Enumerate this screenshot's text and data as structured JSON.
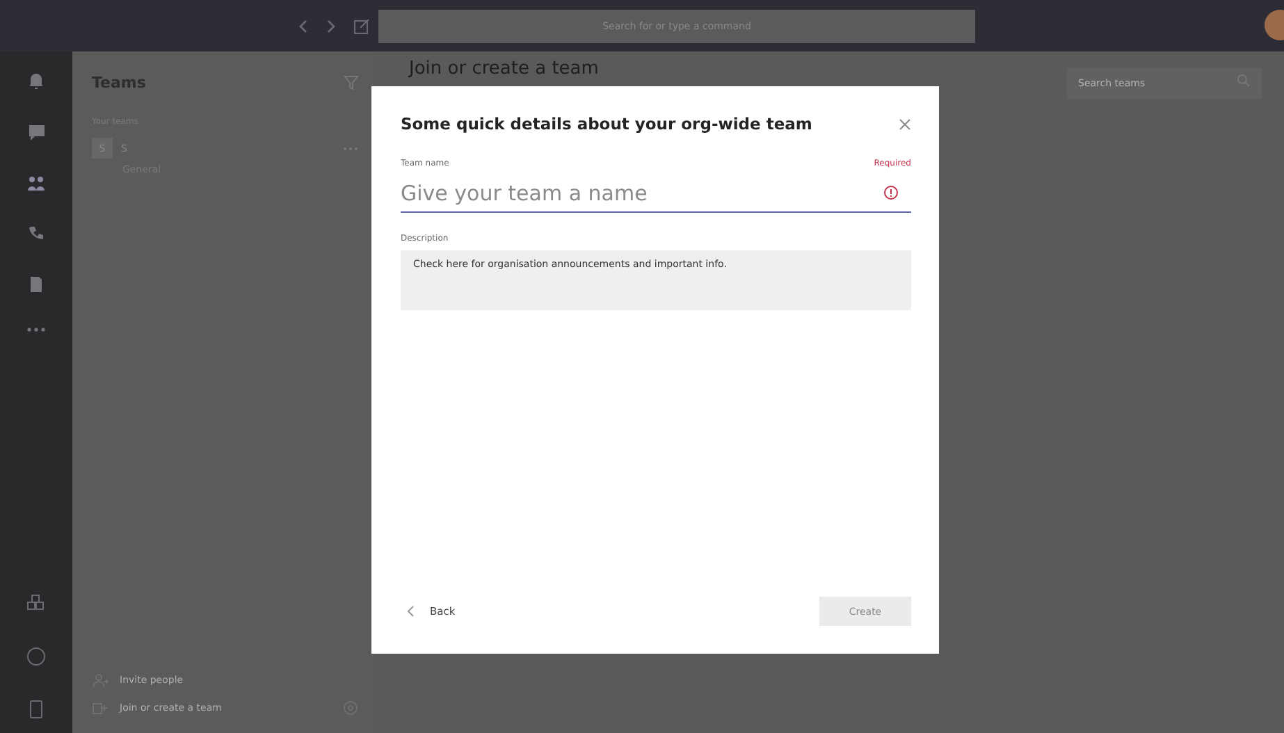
{
  "top_bar": {
    "search": {
      "placeholder": "Search for or type a command"
    }
  },
  "teams_panel": {
    "title": "Teams",
    "section": "Your teams",
    "teams": [
      {
        "avatar": "S",
        "name": "S",
        "channels": [
          {
            "name": "General"
          }
        ]
      }
    ],
    "footer": [
      {
        "kind": "invite",
        "label": "Invite people"
      },
      {
        "kind": "join",
        "label": "Join or create a team"
      }
    ]
  },
  "main": {
    "title": "Join or create a team",
    "search": {
      "placeholder": "Search teams"
    }
  },
  "dialog": {
    "title": "Some quick details about your org-wide team",
    "team_name": {
      "label": "Team name",
      "required": "Required",
      "placeholder": "Give your team a name"
    },
    "description": {
      "label": "Description",
      "value": "Check here for organisation announcements and important info."
    },
    "back": "Back",
    "create": {
      "label": "Create",
      "disabled": true
    }
  }
}
